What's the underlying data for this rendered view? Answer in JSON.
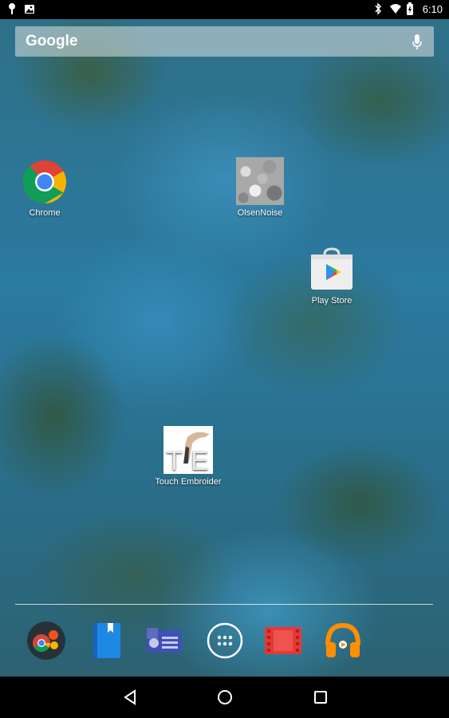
{
  "status_bar": {
    "time": "6:10",
    "left_icons": [
      "pin-icon",
      "image-notification-icon"
    ],
    "right_icons": [
      "bluetooth-icon",
      "wifi-icon",
      "battery-icon"
    ]
  },
  "search": {
    "label": "Google",
    "mic_icon": "mic-icon"
  },
  "apps": [
    {
      "id": "chrome",
      "label": "Chrome",
      "icon": "chrome-icon"
    },
    {
      "id": "olsennoise",
      "label": "OlsenNoise",
      "icon": "noise-texture-icon"
    },
    {
      "id": "playstore",
      "label": "Play Store",
      "icon": "play-store-icon"
    },
    {
      "id": "touchembroider",
      "label": "Touch Embroider",
      "icon": "touch-embroider-icon"
    }
  ],
  "dock": [
    {
      "id": "google-folder",
      "icon": "google-apps-folder-icon"
    },
    {
      "id": "books",
      "icon": "play-books-icon"
    },
    {
      "id": "newsstand",
      "icon": "play-newsstand-icon"
    },
    {
      "id": "all-apps",
      "icon": "app-drawer-icon"
    },
    {
      "id": "movies",
      "icon": "play-movies-icon"
    },
    {
      "id": "music",
      "icon": "play-music-icon"
    }
  ],
  "nav": {
    "back": "back-icon",
    "home": "home-icon",
    "recents": "recents-icon"
  },
  "colors": {
    "status_bar": "#000000",
    "nav_bar": "#000000",
    "chrome_red": "#db4437",
    "chrome_yellow": "#f4b400",
    "chrome_green": "#0f9d58",
    "chrome_blue": "#4285f4",
    "movies_red": "#e53935",
    "music_orange": "#ff8f00"
  }
}
